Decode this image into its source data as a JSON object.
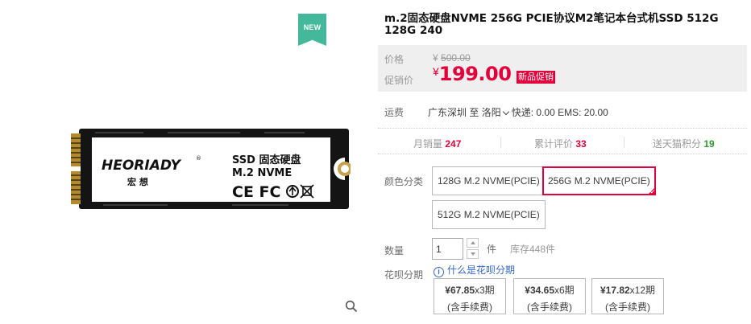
{
  "badge": {
    "new": "NEW"
  },
  "product_image": {
    "brand": "HEORIADY",
    "brand_cn": "宏  想",
    "line1": "SSD 固态硬盘",
    "line2": "M.2 NVME",
    "certs": "CE FC"
  },
  "title": "m.2固态硬盘NVME 256G PCIE协议M2笔记本台式机SSD 512G 128G 240",
  "price": {
    "orig_label": "价格",
    "orig_currency": "¥",
    "orig_value": "500.00",
    "promo_label": "促销价",
    "promo_currency": "¥",
    "promo_value": "199.00",
    "promo_tag": "新品促销"
  },
  "shipping": {
    "label": "运费",
    "from": "广东深圳",
    "to_word": "至",
    "to_city": "洛阳",
    "rates": "快递: 0.00 EMS: 20.00"
  },
  "stats": {
    "monthly_label": "月销量",
    "monthly_value": "247",
    "reviews_label": "累计评价",
    "reviews_value": "33",
    "points_label": "送天猫积分",
    "points_value": "19"
  },
  "sku": {
    "label": "颜色分类",
    "options": [
      "128G M.2 NVME(PCIE)",
      "256G M.2 NVME(PCIE)",
      "512G M.2 NVME(PCIE)"
    ],
    "selected_index": 1
  },
  "quantity": {
    "label": "数量",
    "value": "1",
    "unit": "件",
    "stock": "库存448件"
  },
  "huabei": {
    "label": "花呗分期",
    "info_link": "什么是花呗分期",
    "plans": [
      {
        "amount": "¥67.85",
        "periods": "x3期",
        "note": "(含手续费)"
      },
      {
        "amount": "¥34.65",
        "periods": "x6期",
        "note": "(含手续费)"
      },
      {
        "amount": "¥17.82",
        "periods": "x12期",
        "note": "(含手续费)"
      }
    ]
  },
  "colors": {
    "accent": "#e4003a",
    "badge": "#43b89a",
    "link": "#3366cc",
    "points_green": "#2a9c2a"
  }
}
